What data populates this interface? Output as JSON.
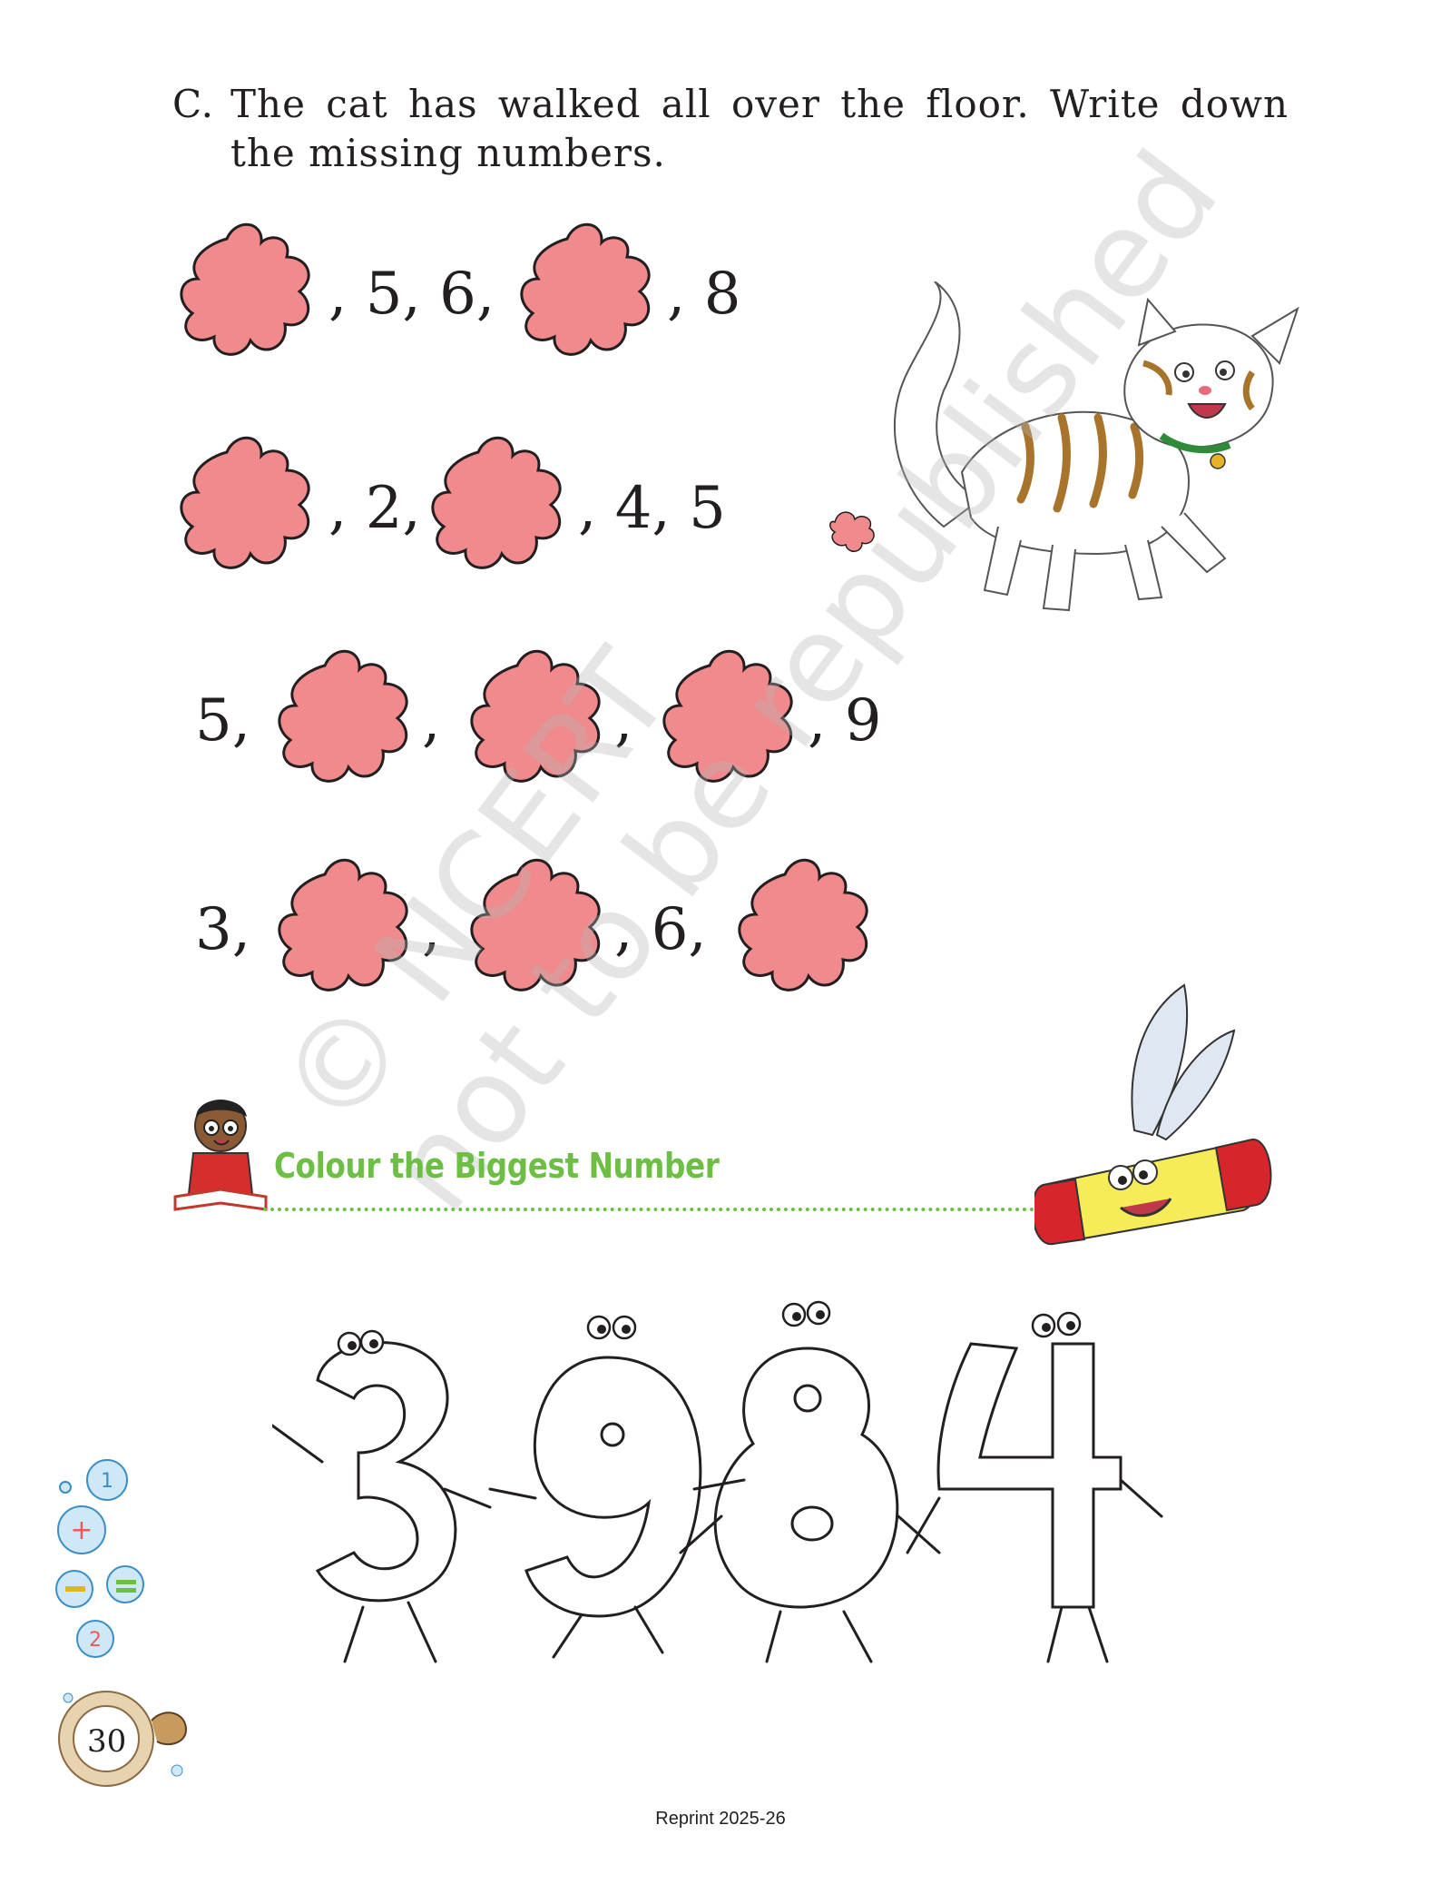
{
  "question": {
    "label": "C.",
    "text": "The cat has walked all over the floor. Write down the missing numbers."
  },
  "sequences": {
    "row1": {
      "t1": ", 5, 6,",
      "t2": ", 8"
    },
    "row2": {
      "t1": ", 2,",
      "t2": ", 4, 5"
    },
    "row3": {
      "t0": "5,",
      "t1": ",",
      "t2": ",",
      "t3": ", 9"
    },
    "row4": {
      "t0": "3,",
      "t1": ",",
      "t2": ", 6,"
    }
  },
  "watermark": {
    "line1": "© NCERT",
    "line2": "not to be republished"
  },
  "section": {
    "title": "Colour the Biggest Number"
  },
  "colouring_numbers": [
    "3",
    "9",
    "8",
    "4"
  ],
  "page": {
    "number": "30",
    "footer": "Reprint 2025-26"
  },
  "colors": {
    "blob": "#f08a8c",
    "accent_green": "#6dbe45"
  },
  "icons": [
    "paw-blob-icon",
    "cat-illustration",
    "kid-reading-icon",
    "flying-crayon-icon",
    "math-symbols-icon"
  ]
}
